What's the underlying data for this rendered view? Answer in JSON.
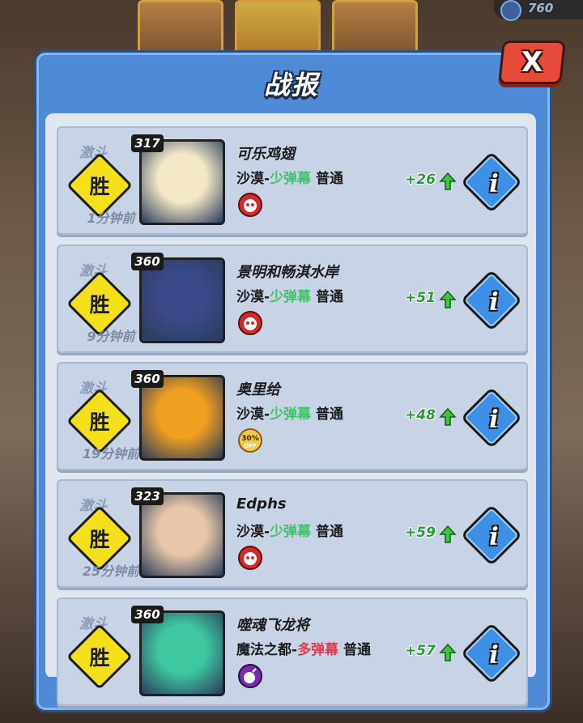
{
  "top": {
    "coin_value": "760"
  },
  "dialog": {
    "title": "战报",
    "close_label": "X"
  },
  "colors": {
    "panel": "#4f8ad6",
    "win": "#f4e01a",
    "few_ammo": "#3ec46a",
    "many_ammo": "#e03a4a",
    "gain": "#2b9a3a"
  },
  "records": [
    {
      "mode": "激斗",
      "result": "胜",
      "time": "1分钟前",
      "level": "317",
      "name": "可乐鸡翅",
      "map_prefix": "沙漠-",
      "ammo": "少弹幕",
      "difficulty": "普通",
      "ammo_type": "few",
      "skill_icon": "red-demon-icon",
      "score": "+26",
      "avatar_color": "#f3e9c8"
    },
    {
      "mode": "激斗",
      "result": "胜",
      "time": "9分钟前",
      "level": "360",
      "name": "景明和畅淇水岸",
      "map_prefix": "沙漠-",
      "ammo": "少弹幕",
      "difficulty": "普通",
      "ammo_type": "few",
      "skill_icon": "red-horn-icon",
      "score": "+51",
      "avatar_color": "#3a4a8a"
    },
    {
      "mode": "激斗",
      "result": "胜",
      "time": "19分钟前",
      "level": "360",
      "name": "奥里给",
      "map_prefix": "沙漠-",
      "ammo": "少弹幕",
      "difficulty": "普通",
      "ammo_type": "few",
      "skill_icon": "discount-30-off-icon",
      "score": "+48",
      "avatar_color": "#f0a020",
      "discount": "30%",
      "discount_sub": "OFF"
    },
    {
      "mode": "激斗",
      "result": "胜",
      "time": "25分钟前",
      "level": "323",
      "name": "Edphs",
      "map_prefix": "沙漠-",
      "ammo": "少弹幕",
      "difficulty": "普通",
      "ammo_type": "few",
      "skill_icon": "red-demon-icon",
      "score": "+59",
      "avatar_color": "#e6c8a8"
    },
    {
      "mode": "激斗",
      "result": "胜",
      "time": "",
      "level": "360",
      "name": "噬魂飞龙将",
      "map_prefix": "魔法之都-",
      "ammo": "多弹幕",
      "difficulty": "普通",
      "ammo_type": "many",
      "skill_icon": "purple-bomb-icon",
      "score": "+57",
      "avatar_color": "#3ec8a0"
    }
  ]
}
